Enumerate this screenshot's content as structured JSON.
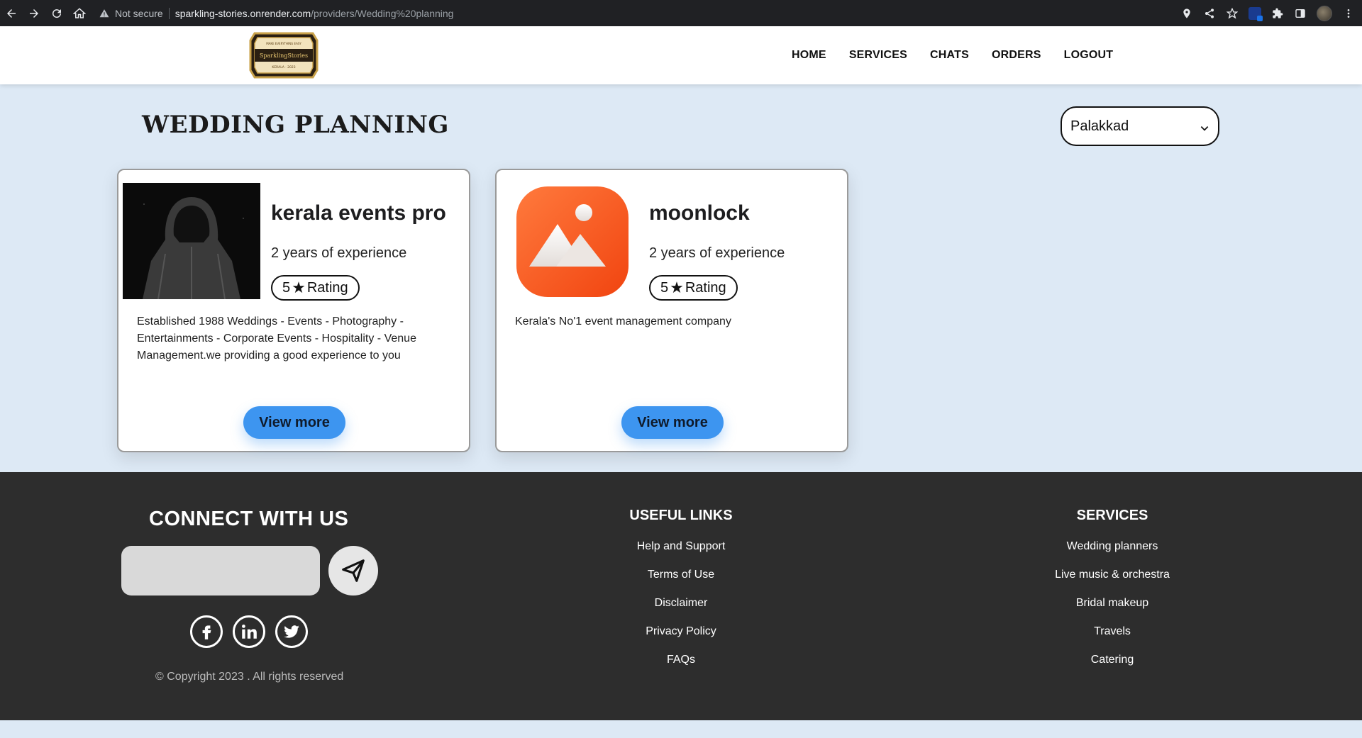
{
  "browser": {
    "not_secure": "Not secure",
    "url_host": "sparkling-stories.onrender.com",
    "url_path": "/providers/Wedding%20planning"
  },
  "logo": {
    "top_text": "MAKE EVERYTHING EASY",
    "brand": "SparklingStories",
    "bottom_text": "KERALA · 2023"
  },
  "nav": {
    "items": [
      "HOME",
      "SERVICES",
      "CHATS",
      "ORDERS",
      "LOGOUT"
    ]
  },
  "page": {
    "title": "WEDDING PLANNING",
    "location": "Palakkad"
  },
  "providers": [
    {
      "name": "kerala events pro",
      "experience": "2 years of experience",
      "rating_value": "5",
      "rating_star": "★",
      "rating_label": "Rating",
      "description": "Established 1988 Weddings - Events - Photography - Entertainments - Corporate Events - Hospitality - Venue Management.we providing a good experience to you",
      "button": "View more",
      "image_icon": "hooded-figure-photo"
    },
    {
      "name": "moonlock",
      "experience": "2 years of experience",
      "rating_value": "5",
      "rating_star": "★",
      "rating_label": "Rating",
      "description": "Kerala's No'1 event management company",
      "button": "View more",
      "image_icon": "image-placeholder-icon"
    }
  ],
  "footer": {
    "connect_title": "CONNECT WITH US",
    "copyright": "© Copyright 2023 . All rights reserved",
    "social_icons": [
      "facebook-icon",
      "linkedin-icon",
      "twitter-icon"
    ],
    "useful_links": {
      "title": "USEFUL LINKS",
      "items": [
        "Help and Support",
        "Terms of Use",
        "Disclaimer",
        "Privacy Policy",
        "FAQs"
      ]
    },
    "services": {
      "title": "SERVICES",
      "items": [
        "Wedding planners",
        "Live music & orchestra",
        "Bridal makeup",
        "Travels",
        "Catering"
      ]
    }
  },
  "colors": {
    "page_bg": "#dde9f5",
    "footer_bg": "#2d2d2d",
    "button_blue": "#3d95f0",
    "placeholder_orange": "#ff5a1f"
  }
}
